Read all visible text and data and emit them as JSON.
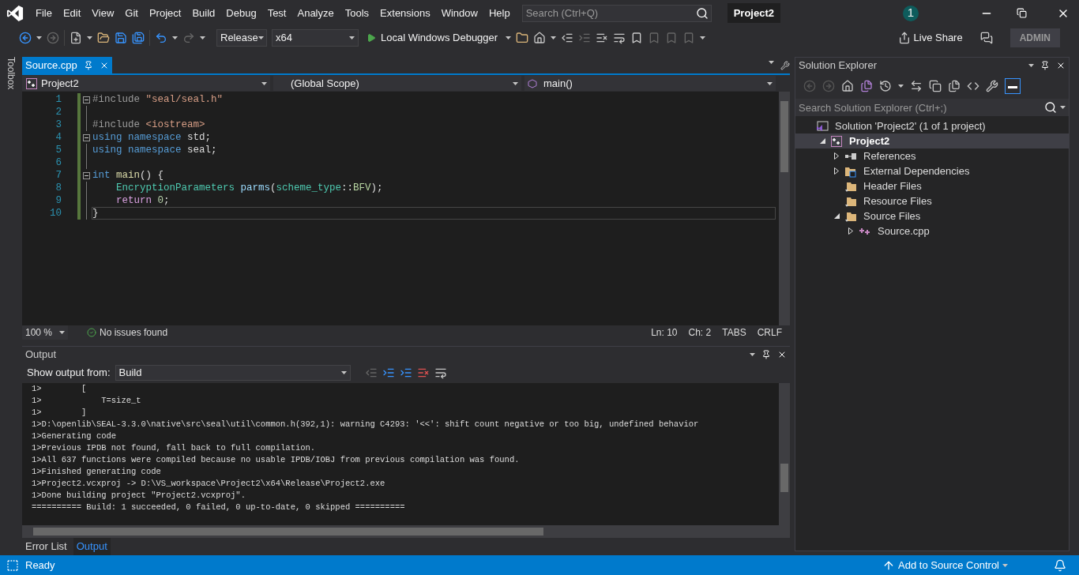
{
  "menu": [
    "File",
    "Edit",
    "View",
    "Git",
    "Project",
    "Build",
    "Debug",
    "Test",
    "Analyze",
    "Tools",
    "Extensions",
    "Window",
    "Help"
  ],
  "search": {
    "placeholder": "Search (Ctrl+Q)"
  },
  "solution_title": "Project2",
  "notification_count": "1",
  "toolbar": {
    "configuration": "Release",
    "platform": "x64",
    "debugger": "Local Windows Debugger",
    "live_share": "Live Share",
    "account": "ADMIN"
  },
  "toolbox": "Toolbox",
  "editor": {
    "tabs": [
      {
        "label": "Source.cpp",
        "selected": true
      }
    ],
    "project": "Project2",
    "scope": "(Global Scope)",
    "member": "main()",
    "lines": [
      {
        "number": "1",
        "collapsible": true,
        "current": false,
        "tokens": [
          {
            "text": "#include",
            "kind": "preproc"
          },
          {
            "text": " \"seal/seal.h\"",
            "kind": "string"
          }
        ]
      },
      {
        "number": "2",
        "collapsible": false,
        "current": false
      },
      {
        "number": "3",
        "collapsible": false,
        "current": false,
        "tokens": [
          {
            "text": "#include",
            "kind": "preproc"
          },
          {
            "text": " <iostream>",
            "kind": "string"
          }
        ]
      },
      {
        "number": "4",
        "collapsible": true,
        "current": false,
        "tokens": [
          {
            "text": "using namespace",
            "kind": "keyword"
          },
          {
            "text": " std;",
            "kind": "plain"
          }
        ]
      },
      {
        "number": "5",
        "collapsible": false,
        "current": false,
        "tokens": [
          {
            "text": "using namespace",
            "kind": "keyword"
          },
          {
            "text": " seal;",
            "kind": "plain"
          }
        ]
      },
      {
        "number": "6",
        "collapsible": false,
        "current": false
      },
      {
        "number": "7",
        "collapsible": true,
        "current": false,
        "tokens": [
          {
            "text": "int",
            "kind": "keyword"
          },
          {
            "text": " main",
            "kind": "func"
          },
          {
            "text": "() {",
            "kind": "plain"
          }
        ]
      },
      {
        "number": "8",
        "collapsible": false,
        "current": false,
        "tokens": [
          {
            "text": "    EncryptionParameters",
            "kind": "type"
          },
          {
            "text": " parms",
            "kind": "variable"
          },
          {
            "text": "(",
            "kind": "plain"
          },
          {
            "text": "scheme_type",
            "kind": "type"
          },
          {
            "text": "::",
            "kind": "plain"
          },
          {
            "text": "BFV",
            "kind": "enum"
          },
          {
            "text": ");",
            "kind": "plain"
          }
        ]
      },
      {
        "number": "9",
        "collapsible": false,
        "current": false,
        "tokens": [
          {
            "text": "    return",
            "kind": "control"
          },
          {
            "text": " 0",
            "kind": "number"
          },
          {
            "text": ";",
            "kind": "plain"
          }
        ]
      },
      {
        "number": "10",
        "collapsible": false,
        "current": true,
        "tokens": [
          {
            "text": "}",
            "kind": "plain"
          }
        ]
      }
    ],
    "zoom": "100 %",
    "issues": "No issues found",
    "line": "Ln: 10",
    "column": "Ch: 2",
    "indent": "TABS",
    "line_ending": "CRLF"
  },
  "output": {
    "title": "Output",
    "show_from_label": "Show output from:",
    "source": "Build",
    "lines": [
      "1>        [",
      "1>            T=size_t",
      "1>        ]",
      "1>D:\\openlib\\SEAL-3.3.0\\native\\src\\seal\\util\\common.h(392,1): warning C4293: '<<': shift count negative or too big, undefined behavior",
      "1>Generating code",
      "1>Previous IPDB not found, fall back to full compilation.",
      "1>All 637 functions were compiled because no usable IPDB/IOBJ from previous compilation was found.",
      "1>Finished generating code",
      "1>Project2.vcxproj -> D:\\VS_workspace\\Project2\\x64\\Release\\Project2.exe",
      "1>Done building project \"Project2.vcxproj\".",
      "========== Build: 1 succeeded, 0 failed, 0 up-to-date, 0 skipped =========="
    ]
  },
  "bottom_tabs": [
    {
      "label": "Error List",
      "selected": false
    },
    {
      "label": "Output",
      "selected": true
    }
  ],
  "solution_explorer": {
    "title": "Solution Explorer",
    "search": {
      "placeholder": "Search Solution Explorer (Ctrl+;)"
    },
    "tree": [
      {
        "label": "Solution 'Project2' (1 of 1 project)",
        "kind": "solution",
        "selected": false,
        "children": [
          {
            "label": "Project2",
            "kind": "project",
            "selected": true,
            "expanded": true,
            "children": [
              {
                "label": "References",
                "kind": "references",
                "selected": false,
                "expanded": false
              },
              {
                "label": "External Dependencies",
                "kind": "external",
                "selected": false,
                "expanded": false
              },
              {
                "label": "Header Files",
                "kind": "folder",
                "selected": false
              },
              {
                "label": "Resource Files",
                "kind": "folder",
                "selected": false
              },
              {
                "label": "Source Files",
                "kind": "folder",
                "selected": false,
                "expanded": true,
                "children": [
                  {
                    "label": "Source.cpp",
                    "kind": "cpp",
                    "selected": false,
                    "expanded": false
                  }
                ]
              }
            ]
          }
        ]
      }
    ]
  },
  "status_bar": {
    "text": "Ready",
    "source_control": "Add to Source Control"
  }
}
